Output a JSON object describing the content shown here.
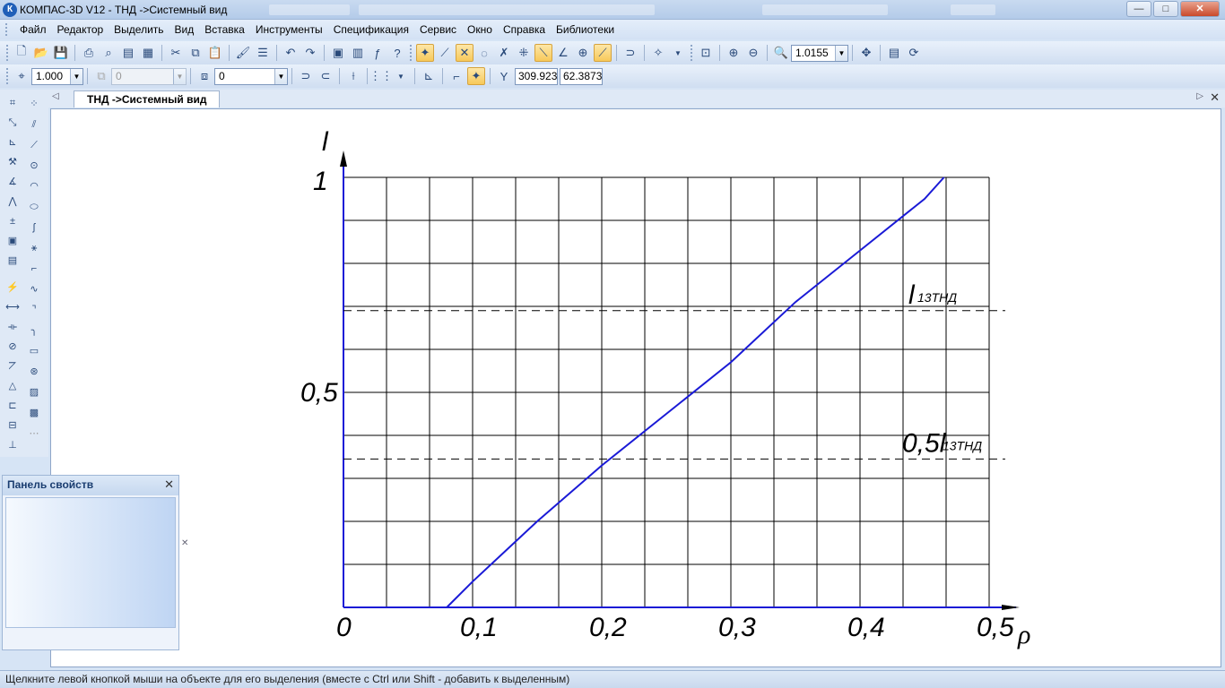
{
  "window": {
    "title": "КОМПАС-3D V12 - ТНД ->Системный вид",
    "logo": "К",
    "controls": [
      "minimize-icon",
      "maximize-icon",
      "close-icon"
    ]
  },
  "menu": [
    "Файл",
    "Редактор",
    "Выделить",
    "Вид",
    "Вставка",
    "Инструменты",
    "Спецификация",
    "Сервис",
    "Окно",
    "Справка",
    "Библиотеки"
  ],
  "toolbar": {
    "zoom_value": "1.0155",
    "scale_value": "1.000",
    "style_value": "0",
    "layer_value": "0",
    "coord_x": "309.923",
    "coord_y": "62.3873",
    "coord_label": "Y"
  },
  "document": {
    "tab_title": "ТНД ->Системный вид"
  },
  "properties_panel": {
    "title": "Панель свойств"
  },
  "status": {
    "hint": "Щелкните левой кнопкой мыши на объекте для его выделения (вместе с Ctrl или Shift - добавить к выделенным)"
  },
  "chart_data": {
    "type": "line",
    "xlabel": "ρ",
    "ylabel": "l",
    "xlim": [
      0,
      0.5
    ],
    "ylim": [
      0,
      1
    ],
    "x_ticks": [
      "0",
      "0,1",
      "0,2",
      "0,3",
      "0,4",
      "0,5"
    ],
    "y_ticks": [
      "0,5",
      "1"
    ],
    "grid": true,
    "series": [
      {
        "x": [
          0.08,
          0.1,
          0.15,
          0.2,
          0.25,
          0.3,
          0.35,
          0.4,
          0.45,
          0.465
        ],
        "y": [
          0.0,
          0.06,
          0.2,
          0.33,
          0.45,
          0.57,
          0.71,
          0.83,
          0.95,
          1.0
        ],
        "color": "#1a1ad6"
      }
    ],
    "reference_lines": [
      {
        "y": 0.69,
        "label_main": "l",
        "label_sub": "13ТНД"
      },
      {
        "y": 0.345,
        "label_main": "0,5l",
        "label_sub": "13ТНД"
      }
    ]
  }
}
